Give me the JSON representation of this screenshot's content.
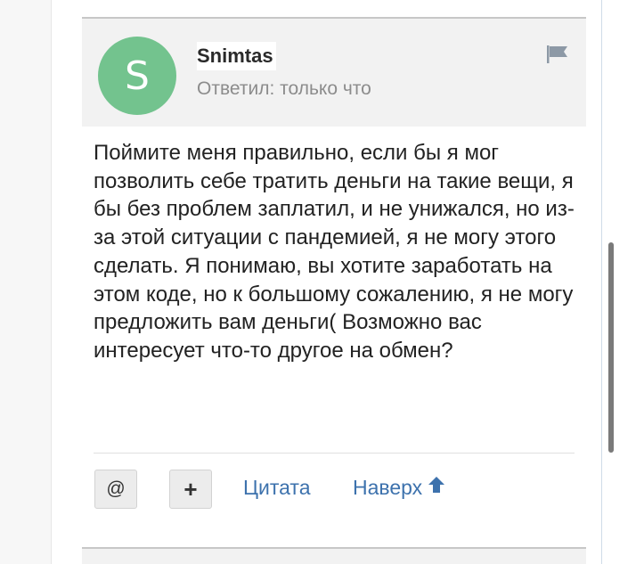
{
  "post": {
    "avatar_letter": "S",
    "avatar_color": "#73c38e",
    "username": "Snimtas",
    "status": "Ответил: только что",
    "flag_icon": "flag-icon",
    "body": "Поймите меня правильно, если бы я мог позволить себе тратить деньги на такие вещи, я бы без проблем заплатил, и не унижался, но из-за этой ситуации с пандемией, я не могу этого сделать. Я понимаю, вы хотите заработать на этом коде, но к большому сожалению, я не могу предложить вам деньги( Возможно вас интересует что-то другое на обмен?"
  },
  "actions": {
    "mention_label": "@",
    "plus_label": "+",
    "quote_label": "Цитата",
    "top_label": "Наверх",
    "top_icon": "arrow-up-icon",
    "link_color": "#3d72ad"
  }
}
